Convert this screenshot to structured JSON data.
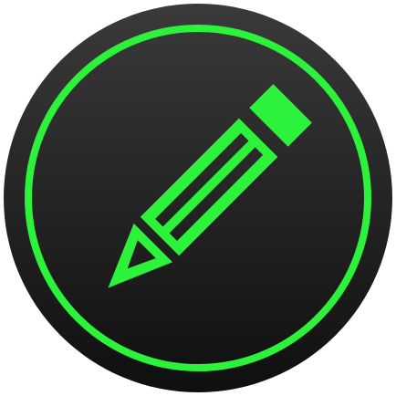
{
  "icon": {
    "name": "pencil-edit-icon",
    "colors": {
      "accent": "#2cf23c",
      "badge_top": "#3a3a3a",
      "badge_bottom": "#0f0f0f",
      "page_background": "#ffffff"
    }
  }
}
